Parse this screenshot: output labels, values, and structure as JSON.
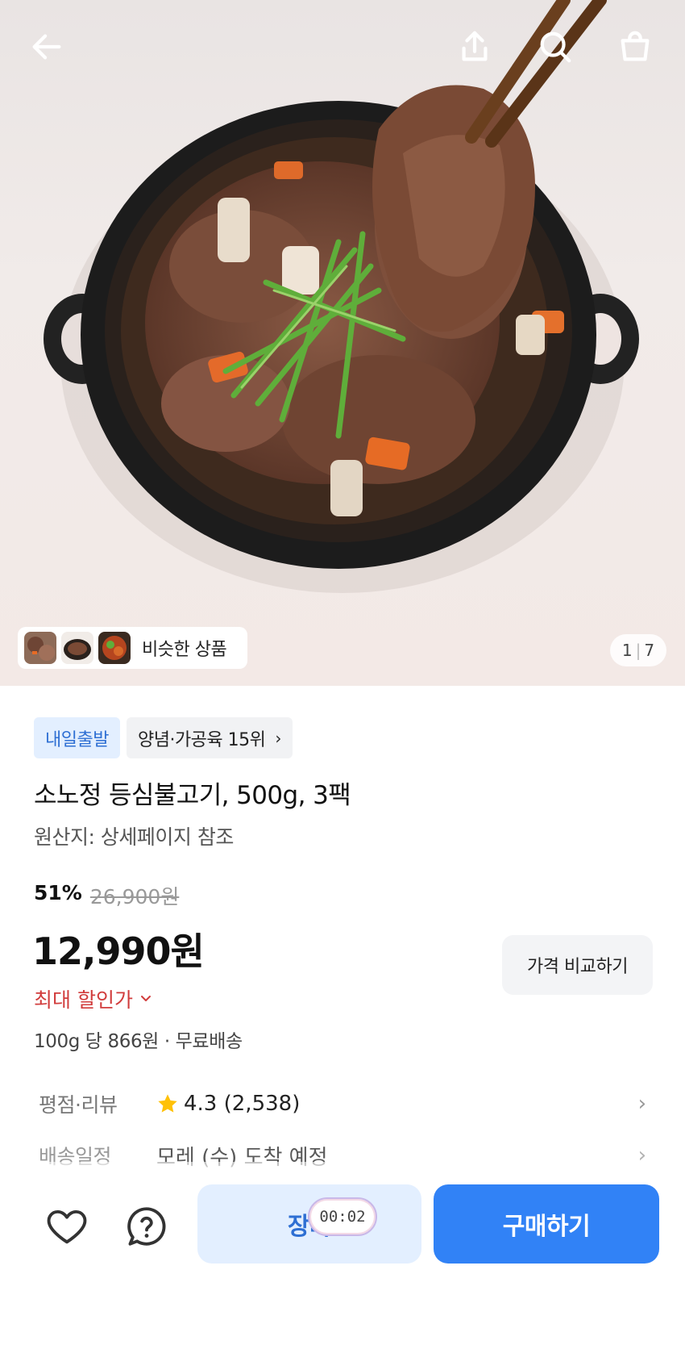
{
  "hero": {
    "pager_current": "1",
    "pager_total": "7",
    "similar_label": "비슷한 상품"
  },
  "icons": {
    "back": "arrow-left-icon",
    "share": "share-icon",
    "search": "search-icon",
    "cart": "shopping-bag-icon",
    "favorite": "heart-icon",
    "help": "question-icon",
    "rating_star": "star-icon"
  },
  "badges": {
    "shipping": "내일출발",
    "ranking": "양념·가공육 15위",
    "ranking_chevron": "›"
  },
  "product": {
    "title": "소노정 등심불고기, 500g, 3팩",
    "origin": "원산지: 상세페이지 참조"
  },
  "pricing": {
    "discount_rate": "51%",
    "original_price": "26,900원",
    "price": "12,990원",
    "max_discount_label": "최대 할인가",
    "max_discount_chevron": "⌄",
    "unit_price": "100g 당 866원 · 무료배송",
    "compare_button": "가격 비교하기"
  },
  "details": {
    "rating_label": "평점·리뷰",
    "rating_value": "4.3 (2,538)",
    "delivery_label": "배송일정",
    "delivery_value": "모레 (수) 도착 예정",
    "arrow": "›"
  },
  "actions": {
    "cart_label": "장바",
    "timer": "00:02",
    "buy_label": "구매하기"
  },
  "colors": {
    "accent": "#3182f6",
    "accent_light": "#e3efff",
    "discount_red": "#d13c3c",
    "star": "#ffc107"
  }
}
